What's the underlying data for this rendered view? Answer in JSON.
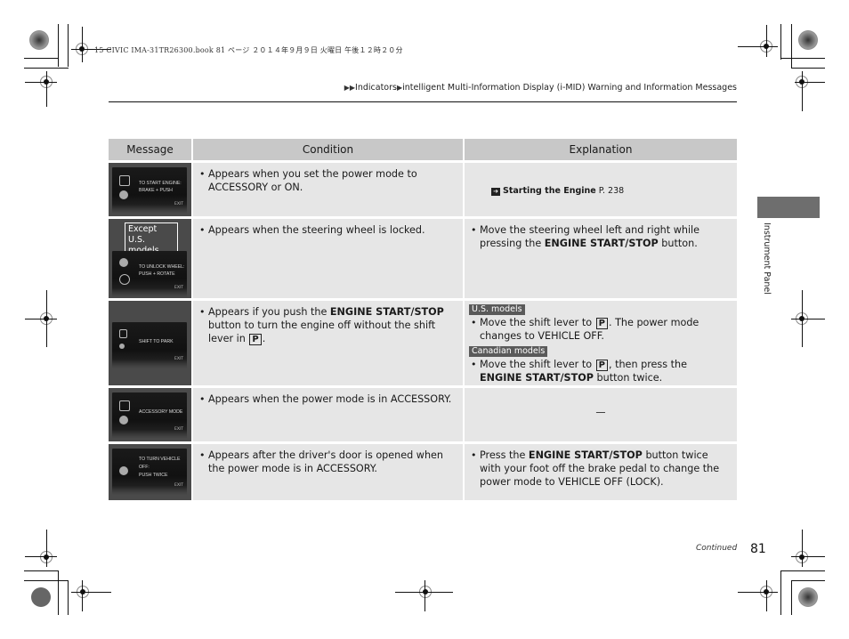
{
  "print_header": "15 CIVIC IMA-31TR26300.book  81 ページ  ２０１４年９月９日  火曜日  午後１２時２０分",
  "breadcrumb": {
    "prefix_icon": "double-triangle-arrow",
    "items": [
      "Indicators",
      "intelligent Multi-Information Display (i-MID) Warning and Information Messages"
    ]
  },
  "table": {
    "headers": [
      "Message",
      "Condition",
      "Explanation"
    ],
    "rows": [
      {
        "screen_lines": [
          "TO START ENGINE:",
          "BRAKE + PUSH"
        ],
        "screen_exit": "EXIT",
        "condition": "Appears when you set the power mode to ACCESSORY or ON.",
        "explanation_ref": {
          "icon": "reference-arrow-icon",
          "title": "Starting the Engine",
          "page": "P. 238"
        }
      },
      {
        "note": "Except U.S. models",
        "screen_lines": [
          "TO UNLOCK WHEEL:",
          "PUSH + ROTATE"
        ],
        "screen_exit": "EXIT",
        "condition": "Appears when the steering wheel is locked.",
        "explanation": {
          "pre": "Move the steering wheel left and right while pressing the ",
          "bold": "ENGINE START/STOP",
          "post": " button."
        }
      },
      {
        "screen_lines": [
          "SHIFT TO PARK"
        ],
        "screen_exit": "EXIT",
        "condition": {
          "pre": "Appears if you push the ",
          "bold": "ENGINE START/STOP",
          "mid": " button to turn the engine off without the shift lever in ",
          "key": "P",
          "post": "."
        },
        "explanation_groups": [
          {
            "tag": "U.S. models",
            "pre": "Move the shift lever to ",
            "key": "P",
            "post": ". The power mode changes to VEHICLE OFF."
          },
          {
            "tag": "Canadian models",
            "pre": "Move the shift lever to ",
            "key": "P",
            "post": ", then press the ",
            "bold": "ENGINE START/STOP",
            "post2": " button twice."
          }
        ]
      },
      {
        "screen_lines": [
          "ACCESSORY MODE"
        ],
        "screen_exit": "EXIT",
        "condition": "Appears when the power mode is in ACCESSORY.",
        "explanation_text": "—"
      },
      {
        "screen_lines": [
          "TO TURN VEHICLE",
          "OFF:",
          "PUSH TWICE"
        ],
        "screen_exit": "EXIT",
        "condition": "Appears after the driver's door is opened when the power mode is in ACCESSORY.",
        "explanation": {
          "pre": "Press the ",
          "bold": "ENGINE START/STOP",
          "post": " button twice with your foot off the brake pedal to change the power mode to VEHICLE OFF (LOCK)."
        }
      }
    ]
  },
  "side_tab": "Instrument Panel",
  "footer": {
    "continued": "Continued",
    "page_number": "81"
  }
}
